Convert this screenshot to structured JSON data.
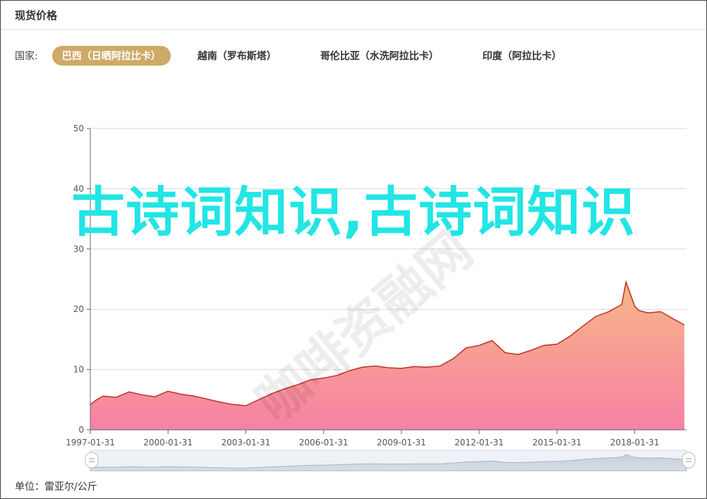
{
  "header": {
    "title": "现货价格"
  },
  "filter": {
    "label": "国家:",
    "tabs": [
      {
        "label": "巴西（日晒阿拉比卡）",
        "active": true
      },
      {
        "label": "越南（罗布斯塔）",
        "active": false
      },
      {
        "label": "哥伦比亚（水洗阿拉比卡）",
        "active": false
      },
      {
        "label": "印度（阿拉比卡）",
        "active": false
      }
    ]
  },
  "footer": {
    "unit": "单位：雷亚尔/公斤"
  },
  "overlay": {
    "text": "古诗词知识,古诗词知识",
    "stamp": "咖啡资融网"
  },
  "colors": {
    "accent": "#cfa968",
    "line": "#c0392b",
    "fill_top": "#f5a37a",
    "fill_bottom": "#f57aa0",
    "overlay_text": "#22e5e5"
  },
  "chart_data": {
    "type": "area",
    "title": "",
    "xlabel": "",
    "ylabel": "",
    "ylim": [
      0,
      50
    ],
    "yticks": [
      0,
      10,
      20,
      30,
      40,
      50
    ],
    "xlim": [
      "1997-01-31",
      "2020-01-31"
    ],
    "xticks": [
      "1997-01-31",
      "2000-01-31",
      "2003-01-31",
      "2006-01-31",
      "2009-01-31",
      "2012-01-31",
      "2015-01-31",
      "2018-01-31"
    ],
    "grid": true,
    "series": [
      {
        "x": [
          "1997-01-31",
          "1997-04-30",
          "1997-07-31",
          "1998-01-31",
          "1998-07-31",
          "1999-01-31",
          "1999-07-31",
          "2000-01-31",
          "2000-07-31",
          "2001-01-31",
          "2001-07-31",
          "2002-01-31",
          "2002-07-31",
          "2003-01-31",
          "2003-07-31",
          "2004-01-31",
          "2004-07-31",
          "2005-01-31",
          "2005-07-31",
          "2006-01-31",
          "2006-07-31",
          "2007-01-31",
          "2007-07-31",
          "2008-01-31",
          "2008-07-31",
          "2009-01-31",
          "2009-07-31",
          "2010-01-31",
          "2010-07-31",
          "2011-01-31",
          "2011-07-31",
          "2012-01-31",
          "2012-07-31",
          "2013-01-31",
          "2013-07-31",
          "2014-01-31",
          "2014-07-31",
          "2015-01-31",
          "2015-07-31",
          "2016-01-31",
          "2016-07-31",
          "2017-01-31",
          "2017-07-31",
          "2017-09-30",
          "2018-01-31",
          "2018-03-31",
          "2018-07-31",
          "2019-01-31",
          "2019-07-31",
          "2019-12-31"
        ],
        "y": [
          4.2,
          5.0,
          5.6,
          5.4,
          6.3,
          5.8,
          5.5,
          6.4,
          5.9,
          5.6,
          5.1,
          4.6,
          4.2,
          4.0,
          5.0,
          6.0,
          6.8,
          7.5,
          8.3,
          8.6,
          9.0,
          9.8,
          10.4,
          10.6,
          10.3,
          10.2,
          10.5,
          10.4,
          10.6,
          11.8,
          13.6,
          14.0,
          14.8,
          12.8,
          12.5,
          13.2,
          14.0,
          14.2,
          15.5,
          17.2,
          18.8,
          19.6,
          20.8,
          24.5,
          20.5,
          19.8,
          19.4,
          19.6,
          18.4,
          17.4
        ]
      }
    ]
  }
}
